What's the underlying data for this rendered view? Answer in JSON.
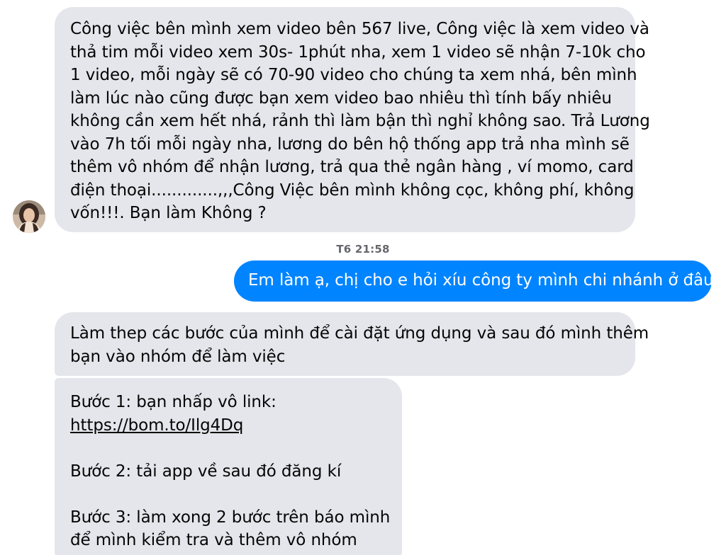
{
  "messages": [
    {
      "direction": "incoming",
      "lines": [
        "Công việc bên mình xem video bên 567 live, Công việc là xem video và",
        "thả tim mỗi video xem 30s- 1phút nha, xem 1 video sẽ nhận 7-10k cho",
        "1 video, mỗi ngày sẽ có 70-90 video cho chúng ta xem nhá, bên mình",
        "làm lúc nào cũng được bạn xem video bao nhiêu thì tính bấy nhiêu",
        "không cần xem hết nhá, rảnh thì làm bận thì nghỉ không sao. Trả Lương",
        "vào 7h tối mỗi ngày nha, lương do bên hộ thống app trả nha mình sẽ",
        "thêm vô nhóm để nhận lương, trả qua thẻ ngân hàng , ví momo, card",
        "điện thoại.............,,,Công Việc bên mình không cọc, không phí, không",
        "vốn!!!. Bạn làm Không ?"
      ]
    },
    {
      "direction": "outgoing",
      "lines": [
        "Em làm ạ, chị cho e hỏi xíu công ty mình chi nhánh ở đâu ạ"
      ]
    },
    {
      "direction": "incoming",
      "lines": [
        "Làm thep các bước của mình để cài đặt ứng dụng và sau đó mình thêm",
        "bạn vào nhóm để làm việc"
      ]
    },
    {
      "direction": "incoming",
      "step1_label": "Bước 1: bạn nhấp vô link:",
      "step1_link": "https://bom.to/Ilg4Dq",
      "step2": "Bước 2: tải app về sau đó đăng kí",
      "step3_line1": "Bước 3: làm xong 2 bước trên báo mình",
      "step3_line2": "để mình kiểm tra và thêm vô nhóm"
    }
  ],
  "timestamp": "T6 21:58",
  "colors": {
    "incoming_bubble": "#e4e6eb",
    "outgoing_bubble": "#0084ff",
    "timestamp_text": "#65676b"
  },
  "avatar": {
    "icon": "contact-avatar-photo"
  }
}
